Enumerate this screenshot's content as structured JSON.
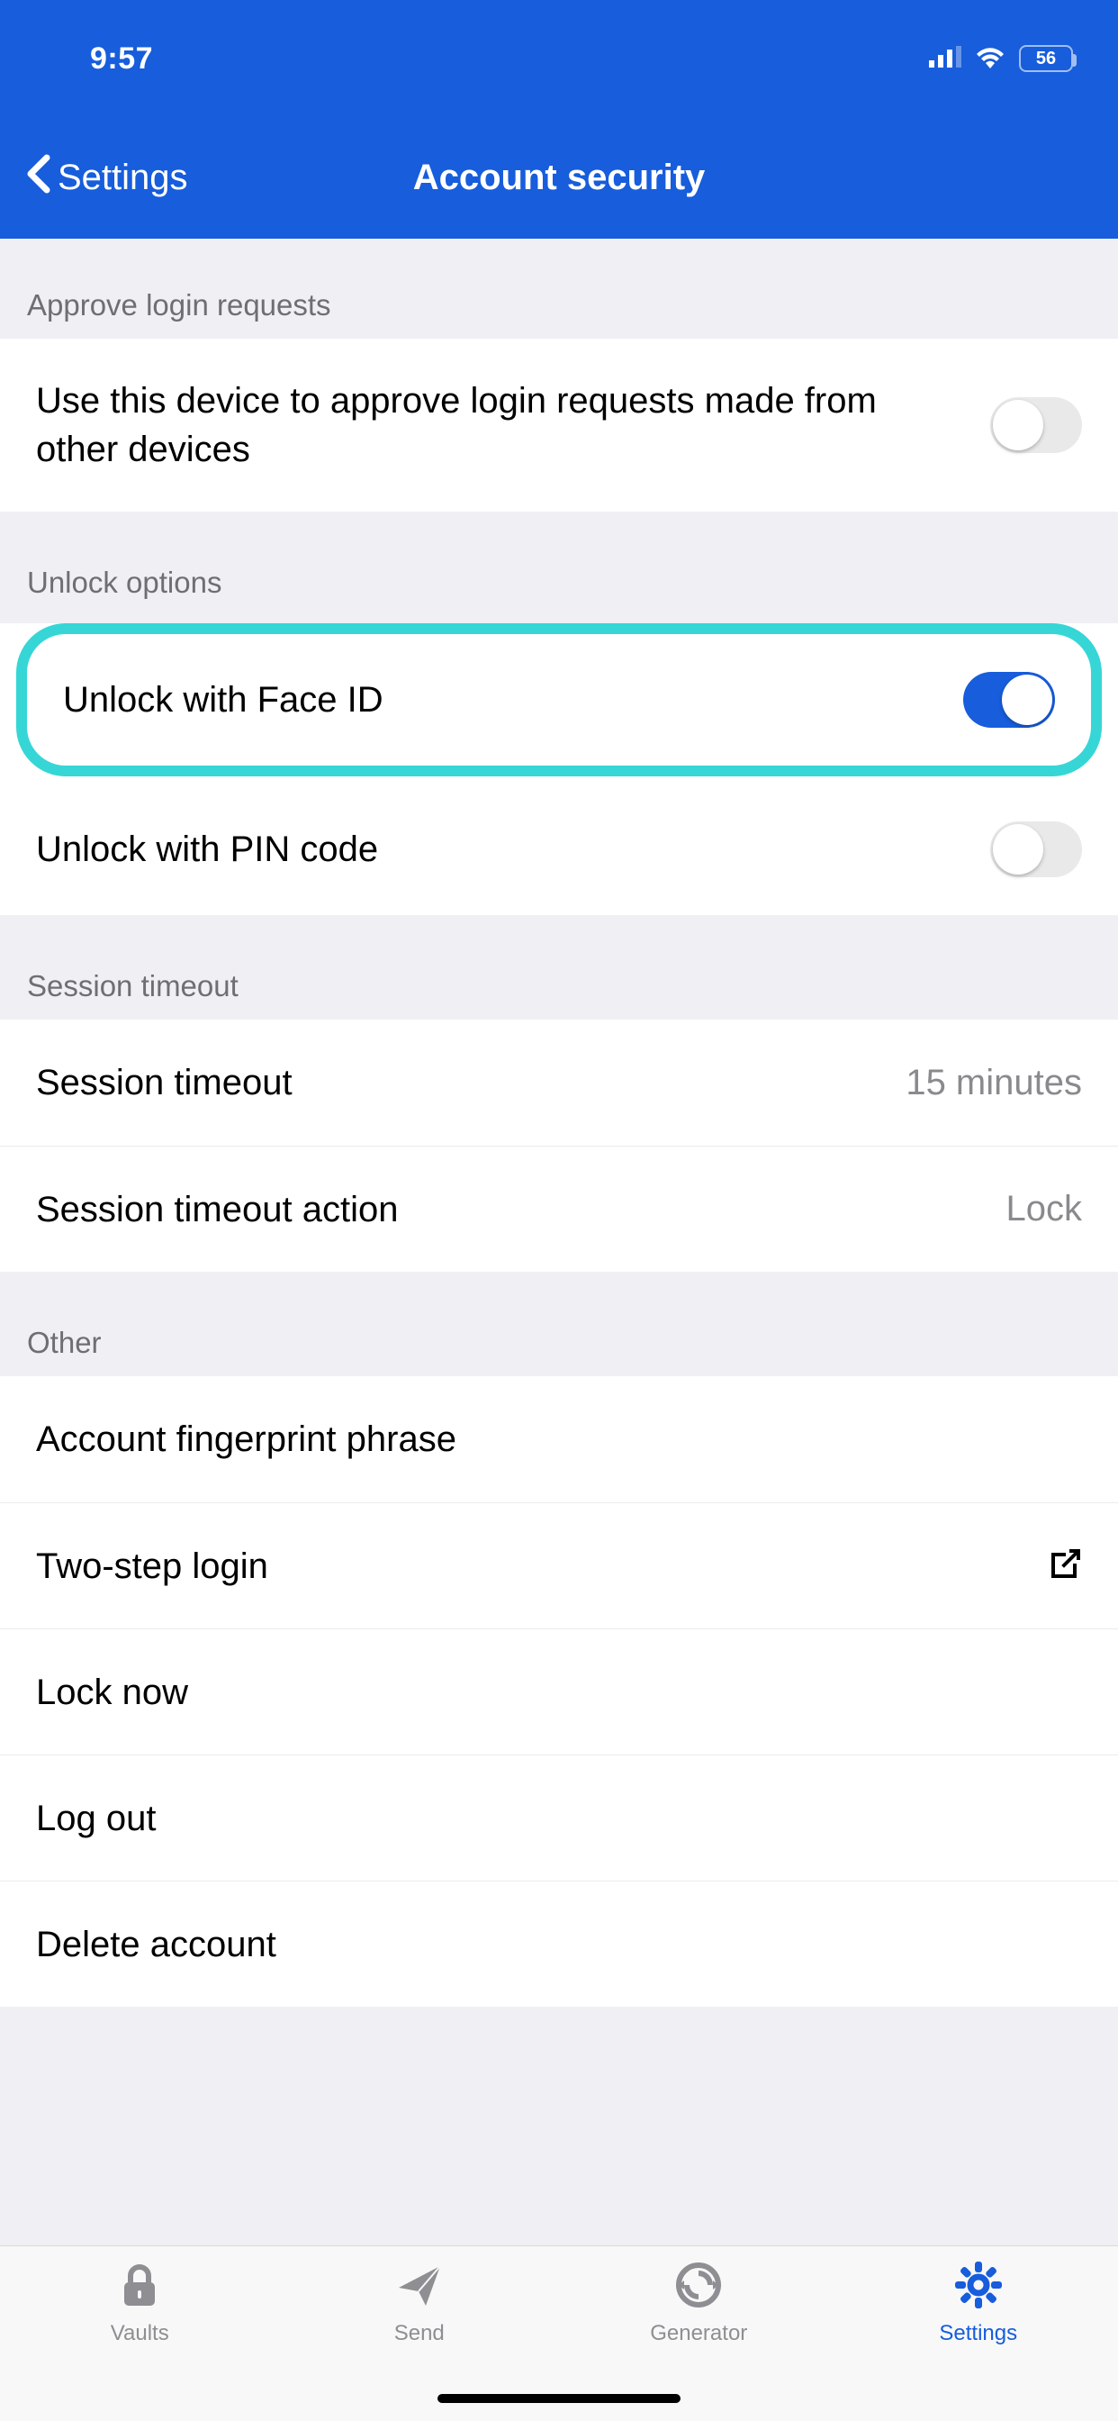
{
  "statusBar": {
    "time": "9:57",
    "battery": "56"
  },
  "nav": {
    "back": "Settings",
    "title": "Account security"
  },
  "sections": {
    "approve": {
      "header": "Approve login requests",
      "row": {
        "label": "Use this device to approve login requests made from other devices",
        "on": false
      }
    },
    "unlock": {
      "header": "Unlock options",
      "faceid": {
        "label": "Unlock with Face ID",
        "on": true
      },
      "pin": {
        "label": "Unlock with PIN code",
        "on": false
      }
    },
    "session": {
      "header": "Session timeout",
      "timeout": {
        "label": "Session timeout",
        "value": "15 minutes"
      },
      "action": {
        "label": "Session timeout action",
        "value": "Lock"
      }
    },
    "other": {
      "header": "Other",
      "fingerprint": "Account fingerprint phrase",
      "twostep": "Two-step login",
      "locknow": "Lock now",
      "logout": "Log out",
      "delete": "Delete account"
    }
  },
  "tabs": {
    "vaults": "Vaults",
    "send": "Send",
    "generator": "Generator",
    "settings": "Settings"
  }
}
